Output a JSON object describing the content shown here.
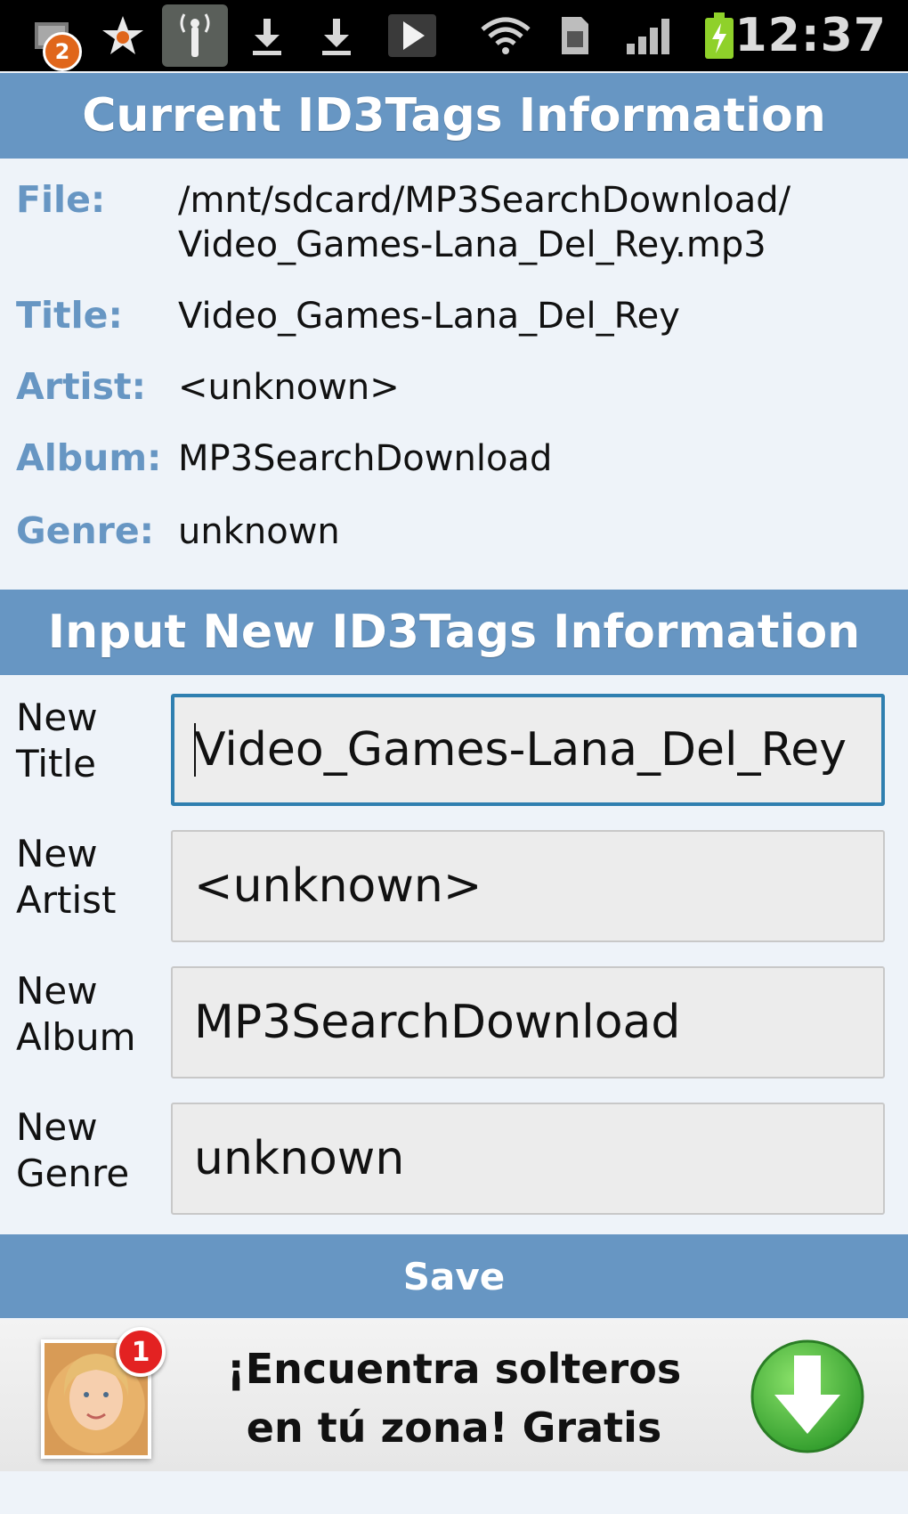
{
  "status_bar": {
    "notification_count": "2",
    "time": "12:37",
    "icons": [
      "app-notification-icon",
      "star-icon",
      "wireless-tether-icon",
      "download-icon",
      "download-icon",
      "play-store-icon",
      "wifi-icon",
      "sd-card-icon",
      "signal-icon",
      "battery-charging-icon"
    ]
  },
  "current": {
    "header": "Current ID3Tags Information",
    "file_label": "File:",
    "file_value_line1": "/mnt/sdcard/MP3SearchDownload/",
    "file_value_line2": "Video_Games-Lana_Del_Rey.mp3",
    "title_label": "Title:",
    "title_value": "Video_Games-Lana_Del_Rey",
    "artist_label": "Artist:",
    "artist_value": "<unknown>",
    "album_label": "Album:",
    "album_value": "MP3SearchDownload",
    "genre_label": "Genre:",
    "genre_value": "unknown"
  },
  "input": {
    "header": "Input New ID3Tags Information",
    "title_label_1": "New",
    "title_label_2": "Title",
    "title_value": "Video_Games-Lana_Del_Rey",
    "artist_label_1": "New",
    "artist_label_2": "Artist",
    "artist_value": "<unknown>",
    "album_label_1": "New",
    "album_label_2": "Album",
    "album_value": "MP3SearchDownload",
    "genre_label_1": "New",
    "genre_label_2": "Genre",
    "genre_value": "unknown"
  },
  "save_label": "Save",
  "ad": {
    "badge_count": "1",
    "line1": "¡Encuentra solteros",
    "line2": "en tú zona! Gratis"
  },
  "colors": {
    "header_blue": "#6796c3",
    "label_blue": "#6796c3",
    "focus_border": "#2f7fb0",
    "background": "#eef3f9"
  }
}
